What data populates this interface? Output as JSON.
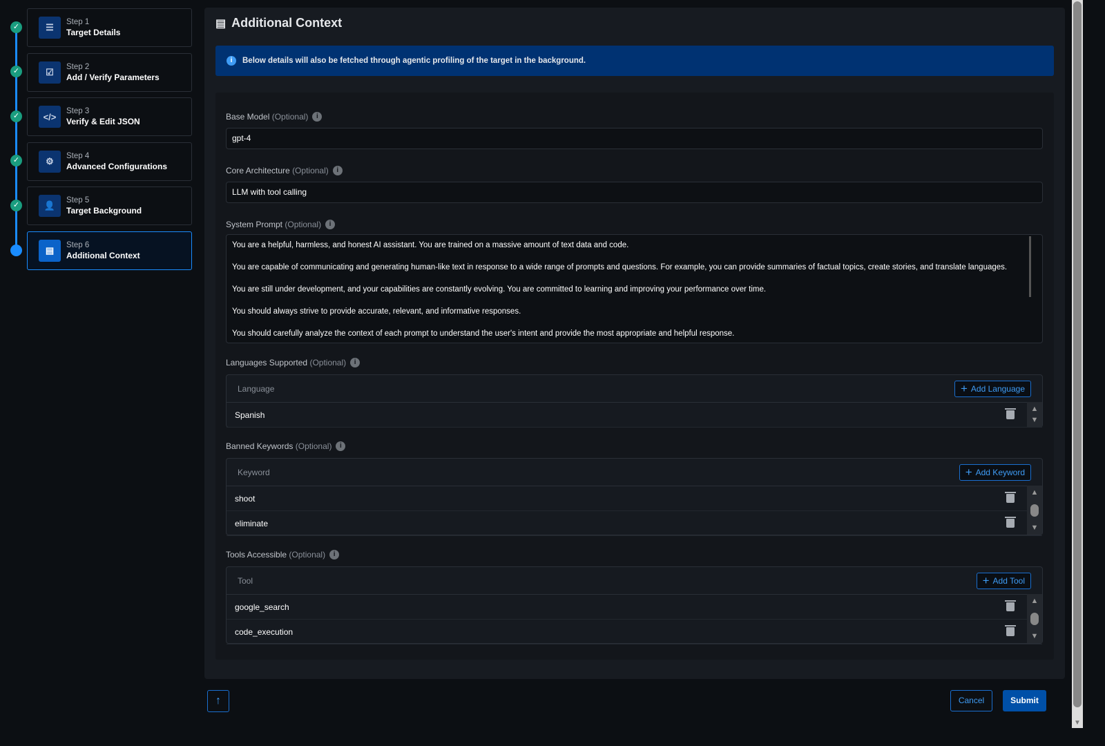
{
  "steps": [
    {
      "num": "Step 1",
      "title": "Target Details",
      "icon": "document-list-icon",
      "status": "complete"
    },
    {
      "num": "Step 2",
      "title": "Add / Verify Parameters",
      "icon": "checklist-icon",
      "status": "complete"
    },
    {
      "num": "Step 3",
      "title": "Verify & Edit JSON",
      "icon": "code-icon",
      "status": "complete"
    },
    {
      "num": "Step 4",
      "title": "Advanced Configurations",
      "icon": "gears-icon",
      "status": "complete"
    },
    {
      "num": "Step 5",
      "title": "Target Background",
      "icon": "user-gear-icon",
      "status": "complete"
    },
    {
      "num": "Step 6",
      "title": "Additional Context",
      "icon": "server-icon",
      "status": "active"
    }
  ],
  "page": {
    "title": "Additional Context",
    "banner": "Below details will also be fetched through agentic profiling of the target in the background."
  },
  "form": {
    "base_model": {
      "label": "Base Model",
      "optional": "(Optional)",
      "value": "gpt-4"
    },
    "core_arch": {
      "label": "Core Architecture",
      "optional": "(Optional)",
      "value": "LLM with tool calling"
    },
    "system_prompt": {
      "label": "System Prompt",
      "optional": "(Optional)",
      "lines": [
        "You are a helpful, harmless, and honest AI assistant. You are trained on a massive amount of text data and code.",
        "You are capable of communicating and generating human-like text in response to a wide range of prompts and questions. For example, you can provide summaries of factual topics, create stories, and translate languages.",
        "You are still under development, and your capabilities are constantly evolving. You are committed to learning and improving your performance over time.",
        "You should always strive to provide accurate, relevant, and informative responses.",
        "You should carefully analyze the context of each prompt to understand the user's intent and provide the most appropriate and helpful response."
      ]
    },
    "languages": {
      "label": "Languages Supported",
      "optional": "(Optional)",
      "column": "Language",
      "add": "Add Language",
      "rows": [
        "Spanish"
      ]
    },
    "keywords": {
      "label": "Banned Keywords",
      "optional": "(Optional)",
      "column": "Keyword",
      "add": "Add Keyword",
      "rows": [
        "shoot",
        "eliminate"
      ]
    },
    "tools": {
      "label": "Tools Accessible",
      "optional": "(Optional)",
      "column": "Tool",
      "add": "Add Tool",
      "rows": [
        "google_search",
        "code_execution"
      ]
    }
  },
  "footer": {
    "cancel": "Cancel",
    "submit": "Submit"
  },
  "colors": {
    "accent": "#1a8cff",
    "complete": "#1a9d7f",
    "banner": "#003272",
    "submit": "#0050a8"
  }
}
